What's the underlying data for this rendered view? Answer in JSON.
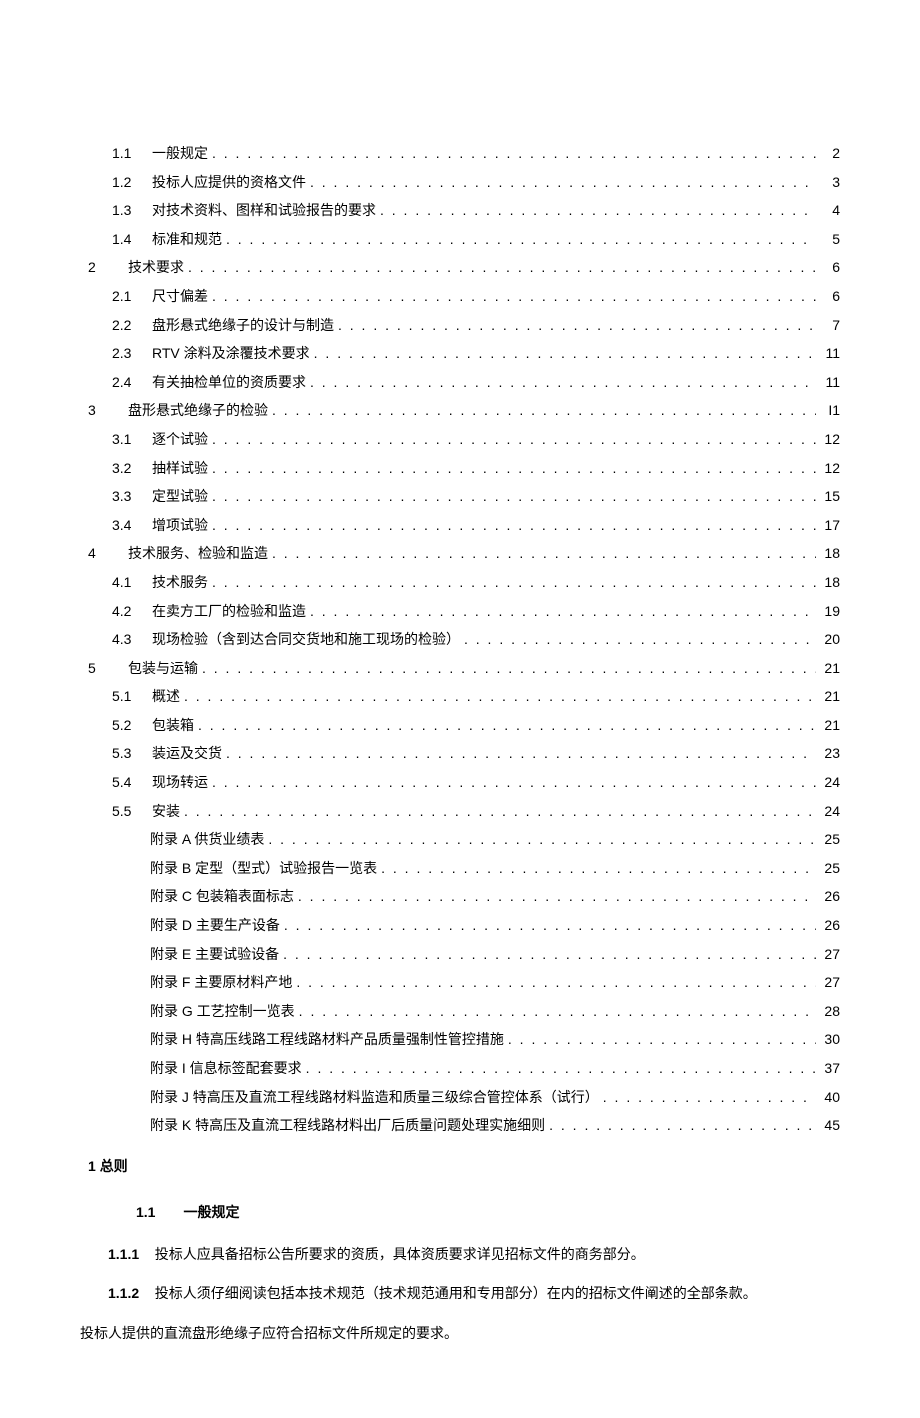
{
  "toc": [
    {
      "level": 2,
      "num": "1.1",
      "title": "一般规定",
      "page": "2"
    },
    {
      "level": 2,
      "num": "1.2",
      "title": "投标人应提供的资格文件",
      "page": "3"
    },
    {
      "level": 2,
      "num": "1.3",
      "title": "对技术资料、图样和试验报告的要求",
      "page": "4"
    },
    {
      "level": 2,
      "num": "1.4",
      "title": "标准和规范",
      "page": "5"
    },
    {
      "level": 1,
      "num": "2",
      "title": "技术要求",
      "page": "6"
    },
    {
      "level": 2,
      "num": "2.1",
      "title": "尺寸偏差",
      "page": "6"
    },
    {
      "level": 2,
      "num": "2.2",
      "title": "盘形悬式绝缘子的设计与制造",
      "page": "7"
    },
    {
      "level": 2,
      "num": "2.3",
      "title": "RTV 涂料及涂覆技术要求",
      "page": "11"
    },
    {
      "level": 2,
      "num": "2.4",
      "title": "有关抽检单位的资质要求",
      "page": "11"
    },
    {
      "level": 1,
      "num": "3",
      "title": "盘形悬式绝缘子的检验",
      "page": "I1"
    },
    {
      "level": 2,
      "num": "3.1",
      "title": "逐个试验",
      "page": "12"
    },
    {
      "level": 2,
      "num": "3.2",
      "title": "抽样试验",
      "page": "12"
    },
    {
      "level": 2,
      "num": "3.3",
      "title": "定型试验",
      "page": "15"
    },
    {
      "level": 2,
      "num": "3.4",
      "title": "增项试验",
      "page": "17"
    },
    {
      "level": 1,
      "num": "4",
      "title": "技术服务、检验和监造",
      "page": "18"
    },
    {
      "level": 2,
      "num": "4.1",
      "title": "技术服务",
      "page": "18"
    },
    {
      "level": 2,
      "num": "4.2",
      "title": "在卖方工厂的检验和监造",
      "page": "19"
    },
    {
      "level": 2,
      "num": "4.3",
      "title": "现场检验（含到达合同交货地和施工现场的检验）",
      "page": "20"
    },
    {
      "level": 1,
      "num": "5",
      "title": "包装与运输",
      "page": "21"
    },
    {
      "level": 2,
      "num": "5.1",
      "title": "概述",
      "page": "21"
    },
    {
      "level": 2,
      "num": "5.2",
      "title": "包装箱",
      "page": "21"
    },
    {
      "level": 2,
      "num": "5.3",
      "title": "装运及交货",
      "page": "23"
    },
    {
      "level": 2,
      "num": "5.4",
      "title": "现场转运",
      "page": "24"
    },
    {
      "level": 2,
      "num": "5.5",
      "title": "安装",
      "page": "24"
    },
    {
      "level": 3,
      "num": "",
      "title": "附录 A 供货业绩表",
      "page": "25"
    },
    {
      "level": 3,
      "num": "",
      "title": "附录 B 定型（型式）试验报告一览表",
      "page": "25"
    },
    {
      "level": 3,
      "num": "",
      "title": "附录 C 包装箱表面标志",
      "page": "26"
    },
    {
      "level": 3,
      "num": "",
      "title": "附录 D 主要生产设备",
      "page": "26"
    },
    {
      "level": 3,
      "num": "",
      "title": "附录 E 主要试验设备",
      "page": "27"
    },
    {
      "level": 3,
      "num": "",
      "title": "附录 F 主要原材料产地",
      "page": "27"
    },
    {
      "level": 3,
      "num": "",
      "title": "附录 G 工艺控制一览表",
      "page": "28"
    },
    {
      "level": 3,
      "num": "",
      "title": "附录 H 特高压线路工程线路材料产品质量强制性管控措施",
      "page": "30"
    },
    {
      "level": 3,
      "num": "",
      "title": "附录 I 信息标签配套要求",
      "page": "37"
    },
    {
      "level": 3,
      "num": "",
      "title": "附录 J 特高压及直流工程线路材料监造和质量三级综合管控体系（试行）",
      "page": "40"
    },
    {
      "level": 3,
      "num": "",
      "title": "附录 K 特高压及直流工程线路材料出厂后质量问题处理实施细则",
      "page": "45"
    }
  ],
  "section1": {
    "num": "1",
    "title": "总则"
  },
  "sub11": {
    "num": "1.1",
    "title": "一般规定"
  },
  "p111": {
    "num": "1.1.1",
    "text": "投标人应具备招标公告所要求的资质，具体资质要求详见招标文件的商务部分。"
  },
  "p112": {
    "num": "1.1.2",
    "text": "投标人须仔细阅读包括本技术规范（技术规范通用和专用部分）在内的招标文件阐述的全部条款。"
  },
  "p_body": "投标人提供的直流盘形绝缘子应符合招标文件所规定的要求。"
}
